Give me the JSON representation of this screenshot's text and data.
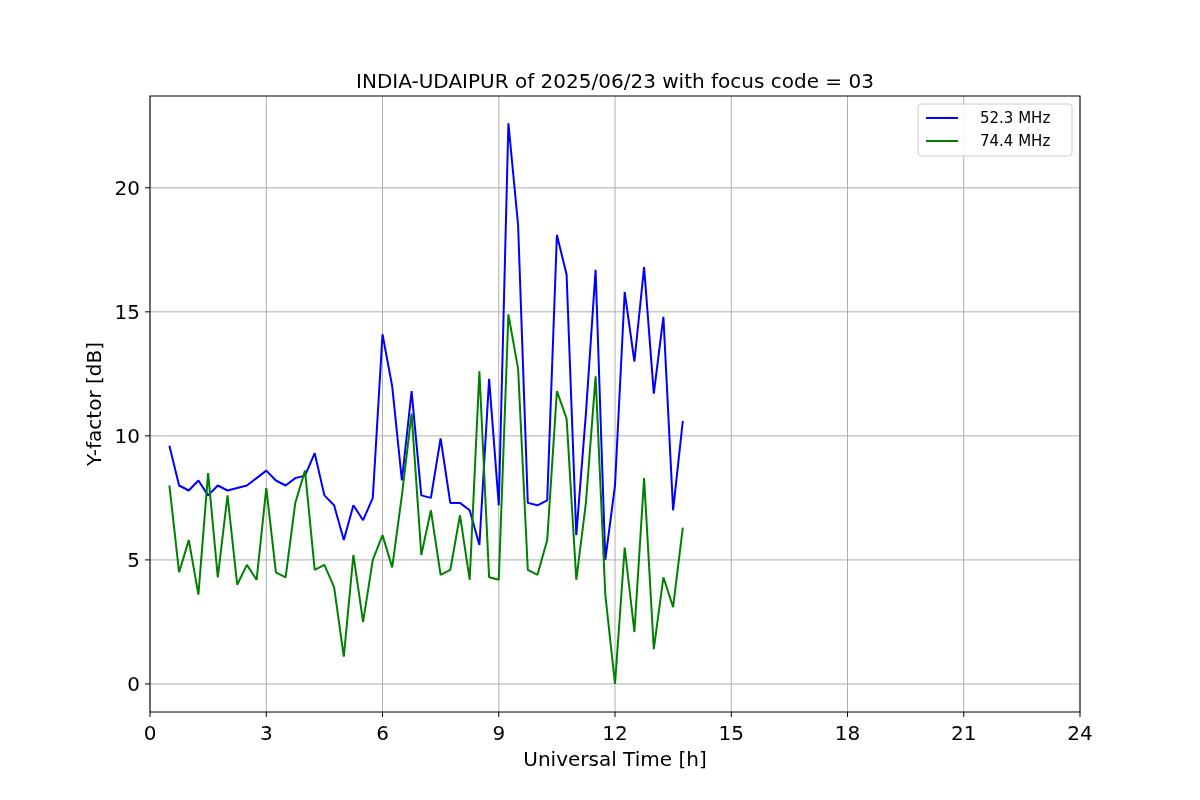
{
  "chart": {
    "chart_data": {
      "type": "line",
      "title": "INDIA-UDAIPUR of 2025/06/23 with focus code = 03",
      "xlabel": "Universal Time [h]",
      "ylabel": "Y-factor [dB]",
      "x": [
        0.5,
        0.75,
        1.0,
        1.25,
        1.5,
        1.75,
        2.0,
        2.25,
        2.5,
        2.75,
        3.0,
        3.25,
        3.5,
        3.75,
        4.0,
        4.25,
        4.5,
        4.75,
        5.0,
        5.25,
        5.5,
        5.75,
        6.0,
        6.25,
        6.5,
        6.75,
        7.0,
        7.25,
        7.5,
        7.75,
        8.0,
        8.25,
        8.5,
        8.75,
        9.0,
        9.25,
        9.5,
        9.75,
        10.0,
        10.25,
        10.5,
        10.75,
        11.0,
        11.25,
        11.5,
        11.75,
        12.0,
        12.25,
        12.5,
        12.75,
        13.0,
        13.25,
        13.5,
        13.75
      ],
      "series": [
        {
          "name": "52.3 MHz",
          "color": "#0000ff",
          "values": [
            9.6,
            8.0,
            7.8,
            8.2,
            7.6,
            8.0,
            7.8,
            7.9,
            8.0,
            8.3,
            8.6,
            8.2,
            8.0,
            8.3,
            8.4,
            9.3,
            7.6,
            7.2,
            5.8,
            7.2,
            6.6,
            7.5,
            14.1,
            12.0,
            8.2,
            11.8,
            7.6,
            7.5,
            9.9,
            7.3,
            7.3,
            7.0,
            5.6,
            12.3,
            7.2,
            22.6,
            18.5,
            7.3,
            7.2,
            7.4,
            18.1,
            16.5,
            6.0,
            10.9,
            16.7,
            5.0,
            8.0,
            15.8,
            13.0,
            16.8,
            11.7,
            14.8,
            7.0,
            10.6
          ]
        },
        {
          "name": "74.4 MHz",
          "color": "#008000",
          "values": [
            8.0,
            4.5,
            5.8,
            3.6,
            8.5,
            4.3,
            7.6,
            4.0,
            4.8,
            4.2,
            7.9,
            4.5,
            4.3,
            7.3,
            8.6,
            4.6,
            4.8,
            3.9,
            1.1,
            5.2,
            2.5,
            5.0,
            6.0,
            4.7,
            7.6,
            10.9,
            5.2,
            7.0,
            4.4,
            4.6,
            6.8,
            4.2,
            12.6,
            4.3,
            4.2,
            14.9,
            12.7,
            4.6,
            4.4,
            5.8,
            11.8,
            10.7,
            4.2,
            7.3,
            12.4,
            3.6,
            0.0,
            5.5,
            2.1,
            8.3,
            1.4,
            4.3,
            3.1,
            6.3
          ]
        }
      ],
      "grid": true,
      "legend": true,
      "xlim": [
        0,
        24
      ],
      "ylim": [
        -1.13,
        23.7
      ],
      "xticks": [
        0,
        3,
        6,
        9,
        12,
        15,
        18,
        21,
        24
      ],
      "yticks": [
        0,
        5,
        10,
        15,
        20
      ]
    }
  }
}
